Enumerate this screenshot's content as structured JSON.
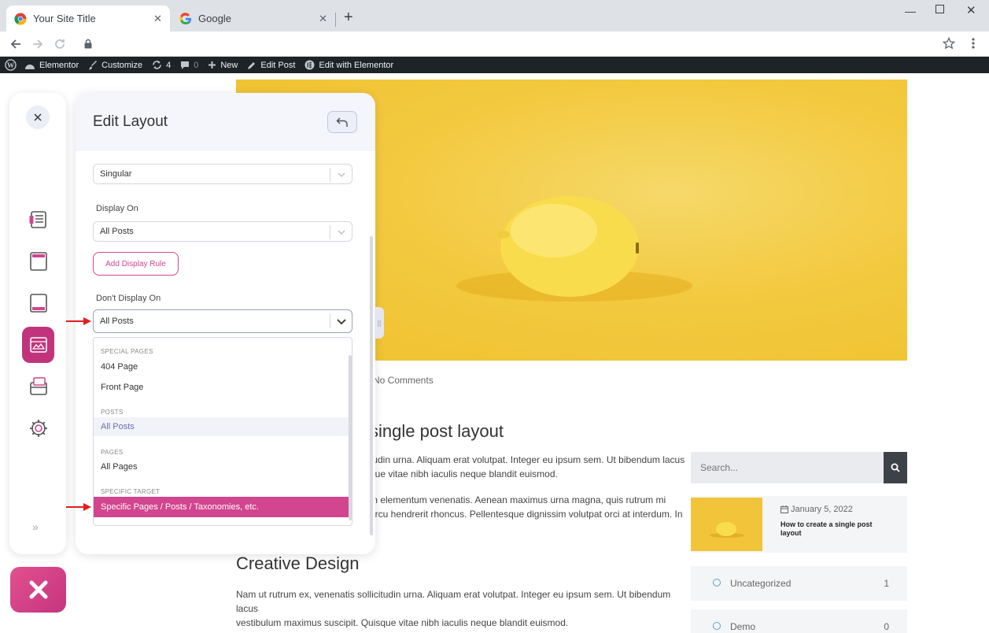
{
  "browser": {
    "tabs": [
      {
        "title": "Your Site Title"
      },
      {
        "title": "Google"
      }
    ],
    "new_tab_symbol": "+"
  },
  "wp_admin_bar": {
    "items": [
      {
        "label": "Elementor"
      },
      {
        "label": "Customize"
      },
      {
        "label": "4"
      },
      {
        "label": "0"
      },
      {
        "label": "New"
      },
      {
        "label": "Edit Post"
      },
      {
        "label": "Edit with Elementor"
      }
    ]
  },
  "panel": {
    "title": "Edit Layout",
    "type_value": "Singular",
    "display_on_label": "Display On",
    "display_on_value": "All Posts",
    "add_rule_label": "Add Display Rule",
    "dont_display_label": "Don't Display On",
    "dont_display_value": "All Posts",
    "dropdown": {
      "groups": [
        {
          "label": "SPECIAL PAGES",
          "options": [
            "404 Page",
            "Front Page"
          ]
        },
        {
          "label": "POSTS",
          "options": [
            "All Posts"
          ]
        },
        {
          "label": "PAGES",
          "options": [
            "All Pages"
          ]
        },
        {
          "label": "SPECIFIC TARGET",
          "options": [
            "Specific Pages / Posts / Taxonomies, etc."
          ]
        }
      ],
      "selected": "All Posts",
      "highlighted": "Specific Pages / Posts / Taxonomies, etc."
    }
  },
  "post": {
    "meta": "No Comments",
    "title": "single post layout",
    "para1": "tudin urna. Aliquam erat volutpat. Integer eu ipsum sem. Ut bibendum lacus\nque vitae nibh iaculis neque blandit euismod.",
    "para2": "m elementum venenatis. Aenean maximus urna magna, quis rutrum mi\narcu hendrerit rhoncus. Pellentesque dignissim volutpat orci at interdum. In",
    "section_title": "Creative Design",
    "para3": "Nam ut rutrum ex, venenatis sollicitudin urna. Aliquam erat volutpat. Integer eu ipsum sem. Ut bibendum lacus\nvestibulum maximus suscipit. Quisque vitae nibh iaculis neque blandit euismod."
  },
  "widgets": {
    "search_placeholder": "Search...",
    "recent_post": {
      "date": "January 5, 2022",
      "title": "How to create a single post layout"
    },
    "categories": [
      {
        "name": "Uncategorized",
        "count": "1"
      },
      {
        "name": "Demo",
        "count": "0"
      }
    ]
  },
  "colors": {
    "accent": "#d2458f",
    "wp_bar": "#1d2327",
    "hero": "#f3c93f"
  }
}
